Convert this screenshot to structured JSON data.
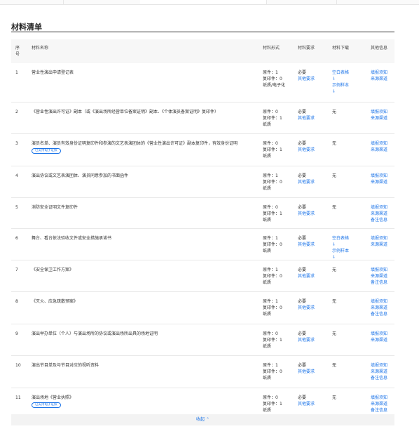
{
  "section_title": "材料清单",
  "headers": {
    "no": "序\n号",
    "name": "材料名称",
    "form": "材料形式",
    "req": "材料要求",
    "dl": "材料下载",
    "other": "其他信息"
  },
  "colors": {
    "link": "#1a73e8"
  },
  "rows": [
    {
      "no": "1",
      "name": "营业性演出申请登记表",
      "form": "原件：1\n复印件：0\n纸质/电子化",
      "req": "必要",
      "req_link": "其他要求",
      "dl": [
        "空白表格",
        "示例样本"
      ],
      "dl_none": "",
      "other": [
        "填报须知",
        "来源渠道"
      ],
      "badge": ""
    },
    {
      "no": "2",
      "name": "《营业性演出许可证》副本（或《演出场所经营单位备案证明》副本、《个体演员备案证明》复印件）",
      "form": "原件：0\n复印件：1\n纸质",
      "req": "必要",
      "req_link": "其他要求",
      "dl": [],
      "dl_none": "无",
      "other": [
        "填报须知",
        "来源渠道"
      ],
      "badge": ""
    },
    {
      "no": "3",
      "name": "演员名单、演员有效身份证明复印件和参演的文艺表演团体的《营业性演出许可证》副本复印件，有效身份证明",
      "form": "原件：0\n复印件：1\n纸质",
      "req": "必要",
      "req_link": "其他要求",
      "dl": [],
      "dl_none": "无",
      "other": [
        "填报须知",
        "来源渠道"
      ],
      "badge": "已支持电子证照"
    },
    {
      "no": "4",
      "name": "演出协议或文艺表演团体、演员同意参加的书面函件",
      "form": "原件：1\n复印件：0\n纸质",
      "req": "必要",
      "req_link": "其他要求",
      "dl": [],
      "dl_none": "无",
      "other": [
        "填报须知",
        "来源渠道"
      ],
      "badge": ""
    },
    {
      "no": "5",
      "name": "消防安全证明文件复印件",
      "form": "原件：0\n复印件：1\n纸质",
      "req": "必要",
      "req_link": "其他要求",
      "dl": [],
      "dl_none": "无",
      "other": [
        "填报须知",
        "来源渠道",
        "备注信息"
      ],
      "badge": ""
    },
    {
      "no": "6",
      "name": "舞台、看台依法验收文件或安全措施承诺书",
      "form": "原件：1\n复印件：0\n纸质",
      "req": "必要",
      "req_link": "其他要求",
      "dl": [
        "空白表格",
        "示例样本"
      ],
      "dl_none": "",
      "other": [
        "填报须知",
        "来源渠道"
      ],
      "badge": ""
    },
    {
      "no": "7",
      "name": "《安全保卫工作方案》",
      "form": "原件：1\n复印件：0\n纸质",
      "req": "必要",
      "req_link": "其他要求",
      "dl": [],
      "dl_none": "无",
      "other": [
        "填报须知",
        "来源渠道",
        "备注信息"
      ],
      "badge": ""
    },
    {
      "no": "8",
      "name": "《灭火、应急疏散预案》",
      "form": "原件：1\n复印件：0\n纸质",
      "req": "必要",
      "req_link": "其他要求",
      "dl": [],
      "dl_none": "无",
      "other": [
        "填报须知",
        "来源渠道",
        "备注信息"
      ],
      "badge": ""
    },
    {
      "no": "9",
      "name": "演出举办单位（个人）与演出场所的协议或演出场所出具的场地证明",
      "form": "原件：0\n复印件：1\n纸质",
      "req": "必要",
      "req_link": "其他要求",
      "dl": [],
      "dl_none": "无",
      "other": [
        "填报须知",
        "来源渠道"
      ],
      "badge": ""
    },
    {
      "no": "10",
      "name": "演出节目单及与节目对应的视听资料",
      "form": "原件：1\n复印件：0\n纸质",
      "req": "必要",
      "req_link": "其他要求",
      "dl": [],
      "dl_none": "无",
      "other": [
        "填报须知",
        "来源渠道",
        "备注信息"
      ],
      "badge": ""
    },
    {
      "no": "11",
      "name": "演出场地《营业执照》",
      "form": "原件：0\n复印件：1\n纸质",
      "req": "必要",
      "req_link": "其他要求",
      "dl": [],
      "dl_none": "无",
      "other": [
        "填报须知",
        "来源渠道",
        "备注信息"
      ],
      "badge": "已支持电子证照"
    }
  ],
  "footer_label": "收起 ⌃"
}
